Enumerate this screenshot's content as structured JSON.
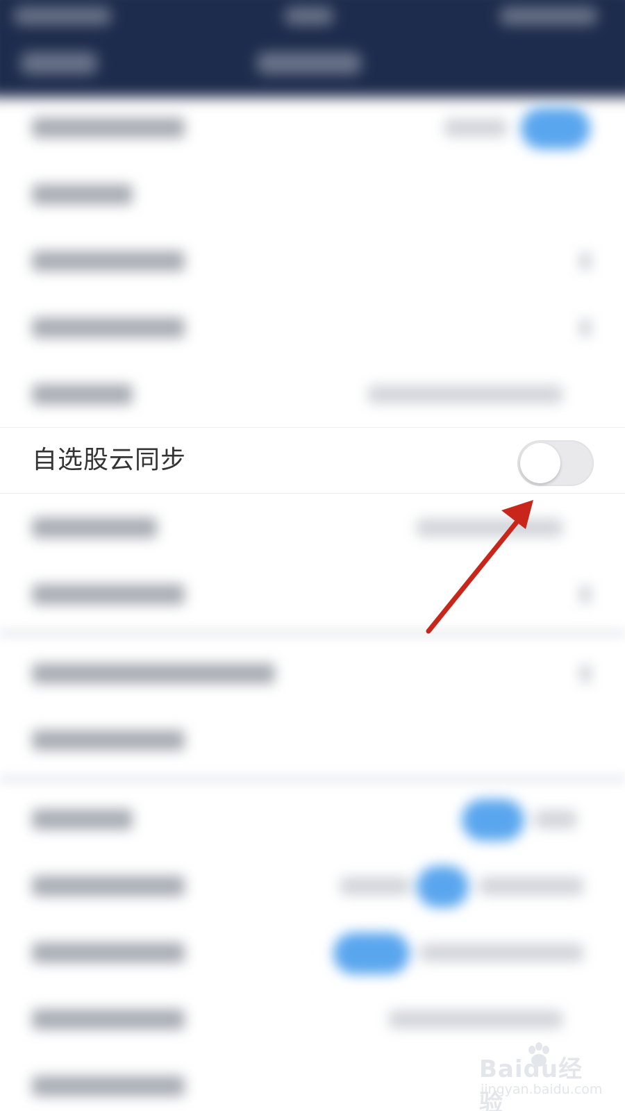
{
  "settings": {
    "cloud_sync": {
      "label": "自选股云同步",
      "enabled": false
    }
  },
  "watermark": {
    "brand": "Baidu经验",
    "site": "jingyan.baidu.com"
  },
  "colors": {
    "nav_background": "#1d2b4c",
    "annotation_arrow": "#c8261b",
    "toggle_track_off": "#e9e9ec",
    "accent_blue": "#5aa6ee"
  },
  "icons": {
    "annotation": "red-arrow-icon",
    "watermark": "baidu-paw-icon"
  }
}
